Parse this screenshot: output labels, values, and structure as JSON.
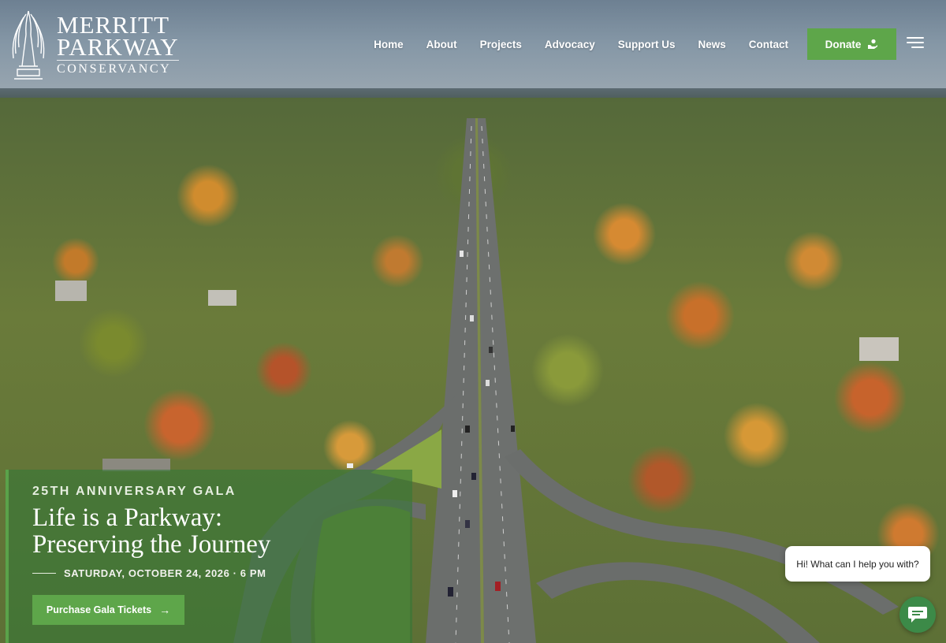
{
  "header": {
    "logo": {
      "line1": "MERRITT",
      "line2": "PARKWAY",
      "line3": "CONSERVANCY"
    },
    "nav": [
      {
        "label": "Home"
      },
      {
        "label": "About"
      },
      {
        "label": "Projects"
      },
      {
        "label": "Advocacy"
      },
      {
        "label": "Support Us"
      },
      {
        "label": "News"
      },
      {
        "label": "Contact"
      }
    ],
    "donate_label": "Donate",
    "donate_icon": "donate-hand-icon",
    "menu_icon": "hamburger-menu-icon"
  },
  "hero": {
    "image": "aerial-view-merritt-parkway-autumn-forest"
  },
  "promo": {
    "kicker": "25TH ANNIVERSARY GALA",
    "title_line1": "Life is a Parkway:",
    "title_line2": "Preserving the Journey",
    "date": "SATURDAY, OCTOBER 24, 2026 · 6 PM",
    "button_label": "Purchase Gala Tickets",
    "button_icon": "arrow-right-icon"
  },
  "chat": {
    "message": "Hi! What can I help you with?",
    "icon": "chat-icon"
  },
  "colors": {
    "accent_green": "#5ea64a",
    "promo_overlay": "#377837",
    "chat_green": "#3c8a48"
  }
}
